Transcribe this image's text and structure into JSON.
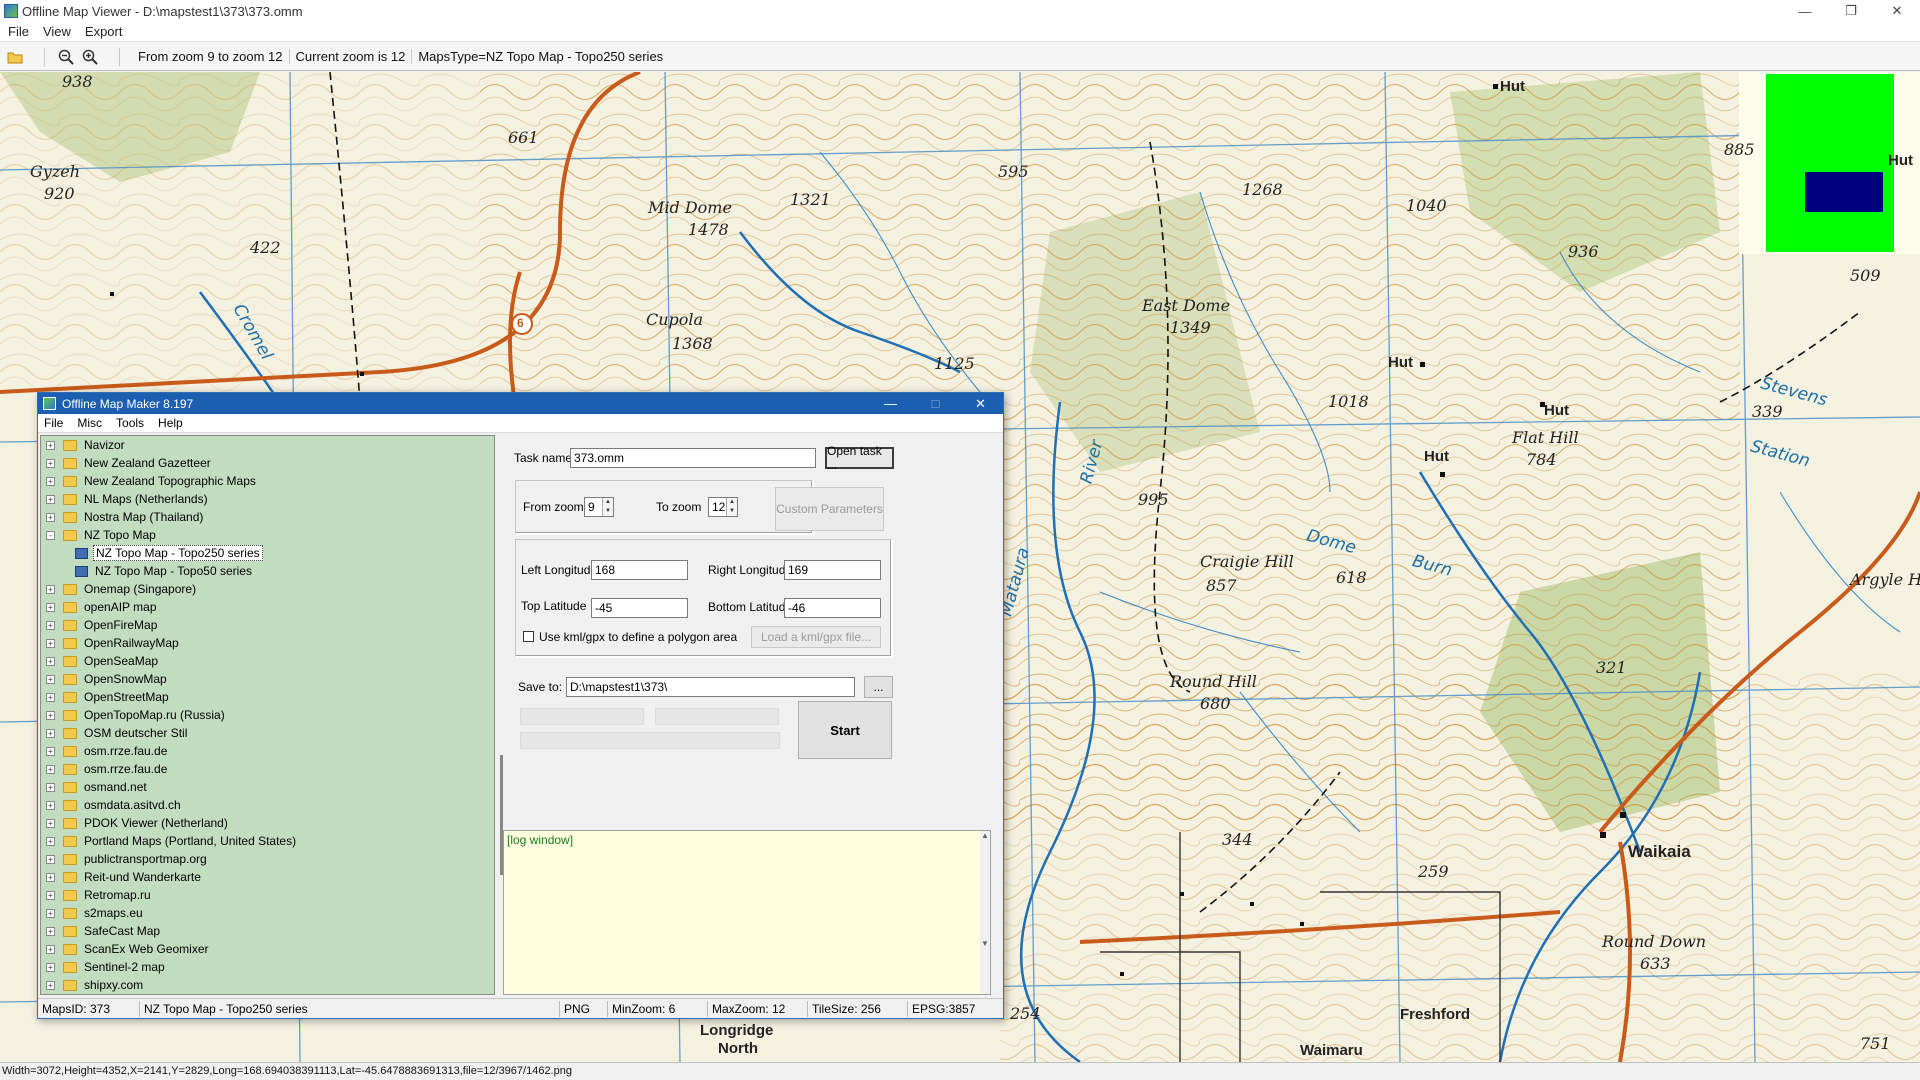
{
  "window": {
    "title": "Offline Map Viewer - D:\\mapstest1\\373\\373.omm",
    "menu": [
      "File",
      "View",
      "Export"
    ]
  },
  "toolbar": {
    "icons": [
      "open-folder-icon",
      "zoom-out-icon",
      "zoom-in-icon"
    ],
    "zoom_range": "From zoom 9 to zoom 12",
    "current_zoom": "Current zoom is 12",
    "maps_type": "MapsType=NZ Topo Map - Topo250 series"
  },
  "map": {
    "labels": {
      "l938": "938",
      "l661": "661",
      "gyzeh": "Gyzeh",
      "l920": "920",
      "l422": "422",
      "cromel": "Cromel",
      "mid_dome": "Mid Dome",
      "l1478": "1478",
      "l1321": "1321",
      "l595": "595",
      "l1268": "1268",
      "cupola": "Cupola",
      "l1368": "1368",
      "east_dome": "East Dome",
      "l1349": "1349",
      "l1125": "1125",
      "l1040": "1040",
      "l936": "936",
      "l885": "885",
      "hut1": "Hut",
      "hut2": "Hut",
      "l509": "509",
      "l1018": "1018",
      "hut3": "Hut",
      "hut4": "Hut",
      "hut5": "Hut",
      "flat_hill": "Flat Hill",
      "l784": "784",
      "l339": "339",
      "l995": "995",
      "craigie": "Craigie Hill",
      "l857": "857",
      "l618": "618",
      "dome_burn": "Dome",
      "burn": "Burn",
      "round_hill": "Round Hill",
      "l680": "680",
      "l321": "321",
      "l344": "344",
      "l259": "259",
      "waikaia": "Waikaia",
      "round_down": "Round Down",
      "l633": "633",
      "freshford": "Freshford",
      "longridge": "Longridge",
      "north": "North",
      "l254": "254",
      "l751": "751",
      "mataura": "Mataura",
      "river": "River",
      "waimaru": "Waimaru",
      "argyle": "Argyle H",
      "stevens": "Stevens",
      "station": "Station",
      "route6": "6"
    },
    "minimap_colors": {
      "background": "#00ff00",
      "viewport": "#00007f"
    }
  },
  "statusbar": {
    "text": "Width=3072,Height=4352,X=2141,Y=2829,Long=168.694038391113,Lat=-45.6478883691313,file=12/3967/1462.png"
  },
  "dialog": {
    "title": "Offline Map Maker 8.197",
    "menu": [
      "File",
      "Misc",
      "Tools",
      "Help"
    ],
    "tree": [
      {
        "label": "Navizor",
        "type": "folder",
        "exp": "+"
      },
      {
        "label": "New Zealand Gazetteer",
        "type": "folder",
        "exp": "+"
      },
      {
        "label": "New Zealand Topographic Maps",
        "type": "folder",
        "exp": "+"
      },
      {
        "label": "NL Maps (Netherlands)",
        "type": "folder",
        "exp": "+"
      },
      {
        "label": "Nostra Map (Thailand)",
        "type": "folder",
        "exp": "+"
      },
      {
        "label": "NZ Topo Map",
        "type": "folder",
        "exp": "-"
      },
      {
        "label": "NZ Topo Map - Topo250 series",
        "type": "map",
        "selected": true
      },
      {
        "label": "NZ Topo Map - Topo50 series",
        "type": "map"
      },
      {
        "label": "Onemap (Singapore)",
        "type": "folder",
        "exp": "+"
      },
      {
        "label": "openAIP map",
        "type": "folder",
        "exp": "+"
      },
      {
        "label": "OpenFireMap",
        "type": "folder",
        "exp": "+"
      },
      {
        "label": "OpenRailwayMap",
        "type": "folder",
        "exp": "+"
      },
      {
        "label": "OpenSeaMap",
        "type": "folder",
        "exp": "+"
      },
      {
        "label": "OpenSnowMap",
        "type": "folder",
        "exp": "+"
      },
      {
        "label": "OpenStreetMap",
        "type": "folder",
        "exp": "+"
      },
      {
        "label": "OpenTopoMap.ru (Russia)",
        "type": "folder",
        "exp": "+"
      },
      {
        "label": "OSM deutscher Stil",
        "type": "folder",
        "exp": "+"
      },
      {
        "label": "osm.rrze.fau.de",
        "type": "folder",
        "exp": "+"
      },
      {
        "label": "osm.rrze.fau.de",
        "type": "folder",
        "exp": "+"
      },
      {
        "label": "osmand.net",
        "type": "folder",
        "exp": "+"
      },
      {
        "label": "osmdata.asitvd.ch",
        "type": "folder",
        "exp": "+"
      },
      {
        "label": "PDOK Viewer (Netherland)",
        "type": "folder",
        "exp": "+"
      },
      {
        "label": "Portland Maps (Portland, United States)",
        "type": "folder",
        "exp": "+"
      },
      {
        "label": "publictransportmap.org",
        "type": "folder",
        "exp": "+"
      },
      {
        "label": "Reit-und Wanderkarte",
        "type": "folder",
        "exp": "+"
      },
      {
        "label": "Retromap.ru",
        "type": "folder",
        "exp": "+"
      },
      {
        "label": "s2maps.eu",
        "type": "folder",
        "exp": "+"
      },
      {
        "label": "SafeCast Map",
        "type": "folder",
        "exp": "+"
      },
      {
        "label": "ScanEx Web Geomixer",
        "type": "folder",
        "exp": "+"
      },
      {
        "label": "Sentinel-2 map",
        "type": "folder",
        "exp": "+"
      },
      {
        "label": "shipxy.com",
        "type": "folder",
        "exp": "+"
      }
    ],
    "task_name_label": "Task name",
    "task_name_value": "373.omm",
    "open_task_btn": "Open task ...",
    "from_zoom_label": "From zoom",
    "from_zoom_value": "9",
    "to_zoom_label": "To zoom",
    "to_zoom_value": "12",
    "custom_params_btn": "Custom Parameters",
    "left_lon_label": "Left Longitude",
    "left_lon_value": "168",
    "right_lon_label": "Right Longitude",
    "right_lon_value": "169",
    "top_lat_label": "Top Latitude",
    "top_lat_value": "-45",
    "bottom_lat_label": "Bottom Latitude",
    "bottom_lat_value": "-46",
    "kml_checkbox_label": "Use kml/gpx to define a polygon area",
    "kml_checked": false,
    "load_kml_btn": "Load a kml/gpx file...",
    "save_to_label": "Save to:",
    "save_to_value": "D:\\mapstest1\\373\\",
    "browse_btn": "...",
    "start_btn": "Start",
    "log_text": "[log window]",
    "status": {
      "maps_id": "MapsID: 373",
      "map_name": "NZ Topo Map - Topo250 series",
      "format": "PNG",
      "min_zoom": "MinZoom: 6",
      "max_zoom": "MaxZoom: 12",
      "tile_size": "TileSize: 256",
      "epsg": "EPSG:3857"
    }
  }
}
